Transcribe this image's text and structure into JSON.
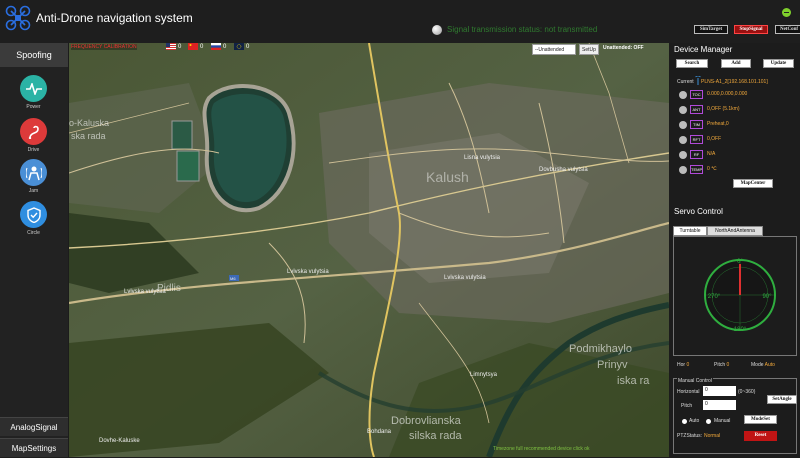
{
  "app": {
    "title": "Anti-Drone navigation system"
  },
  "signal": {
    "status_text": "Signal transmission status: not transmitted"
  },
  "toolbar": {
    "sim_label": "SimTarget",
    "stop_label": "StopSignal",
    "net_label": "NetConf"
  },
  "sidebar": {
    "top_tab": "Spoofing",
    "buttons": [
      {
        "label": "Power",
        "icon": "waveform-icon",
        "color": "#2bb3a5"
      },
      {
        "label": "Drive",
        "icon": "path-curve-icon",
        "color": "#dd3a3a"
      },
      {
        "label": "Jam",
        "icon": "person-jam-icon",
        "color": "#4a8fd6"
      },
      {
        "label": "Circle",
        "icon": "shield-check-icon",
        "color": "#2f8ee0"
      }
    ],
    "bottom_tabs": [
      "AnalogSignal",
      "MapSettings"
    ]
  },
  "map": {
    "coord_text": "FREQUENCY CALIBRATION",
    "flags": [
      {
        "icon": "us-flag-icon",
        "count": "0"
      },
      {
        "icon": "cn-flag-icon",
        "count": "0"
      },
      {
        "icon": "ru-flag-icon",
        "count": "0"
      },
      {
        "icon": "eu-flag-icon",
        "count": "0"
      }
    ],
    "mode_select": "--Unattended",
    "setup_label": "SetUp",
    "unattended_status": "Unattended: OFF",
    "labels": {
      "kalush": "Kalush",
      "kaluska": "o-Kaluska",
      "kaluska2": "ska rada",
      "podmykhaylo": "Podmikhaylo",
      "podmykhaylo2": "Prinyv",
      "podmykhaylo3": "iska ra",
      "dobroviiany": "Dobrovlianska",
      "dobroviiany2": "silska rada",
      "pidlis": "Pidlis",
      "dovhe": "Dovhe-Kaluske",
      "road1": "Lvivska vulytsia",
      "road2": "Lvivska vulytsia",
      "road3": "Lvivska vulytsia",
      "road4": "Dovbusha vulytsia",
      "road5": "Lisna vulytsia",
      "road6": "Limnytsya",
      "road7": "Bohdana",
      "m6": "M6"
    },
    "footer_text": "Timezone full recommended device click ok"
  },
  "device_manager": {
    "title": "Device Manager",
    "buttons": [
      "Search",
      "Add",
      "Update"
    ],
    "current_label": "Current",
    "current_value": "PLNS-A1_2[192.168.101.101]",
    "rows": [
      {
        "tag": "TOC",
        "value": "0.000,0.000,0.000"
      },
      {
        "tag": "ANT",
        "value": "0,OFF (5.1km)"
      },
      {
        "tag": "TIM",
        "value": "Preheat,0"
      },
      {
        "tag": "RFT",
        "value": "0,OFF"
      },
      {
        "tag": "RF",
        "value": "N/A"
      },
      {
        "tag": "TEMP",
        "value": "0 ℃"
      }
    ],
    "map_center_label": "MapCenter"
  },
  "servo": {
    "title": "Servo Control",
    "tabs": [
      "Turntable",
      "NorthAndAntenna"
    ],
    "dial": {
      "heading_deg": 0,
      "north": "0°",
      "east": "90°",
      "south": "180°",
      "west": "270°"
    },
    "hor_label": "Hor",
    "hor_value": "0",
    "pitch_label": "Pitch",
    "pitch_value": "0",
    "mode_label": "Mode",
    "mode_value": "Auto"
  },
  "manual": {
    "title": "Manual Control",
    "horizontal_label": "Horizontal",
    "horizontal_value": "0",
    "horizontal_range": "(0~360)",
    "pitch_label": "Pitch",
    "pitch_value": "0",
    "set_angle_label": "SetAngle",
    "auto_label": "Auto",
    "manual_label": "Manual",
    "mode_set_label": "ModeSet",
    "ptz_label": "PTZStatus:",
    "ptz_value": "Normal",
    "reset_label": "Reset"
  },
  "colors": {
    "accent_orange": "#f2a93b",
    "stop_red": "#9a1010",
    "status_green": "#2f7a2f"
  }
}
